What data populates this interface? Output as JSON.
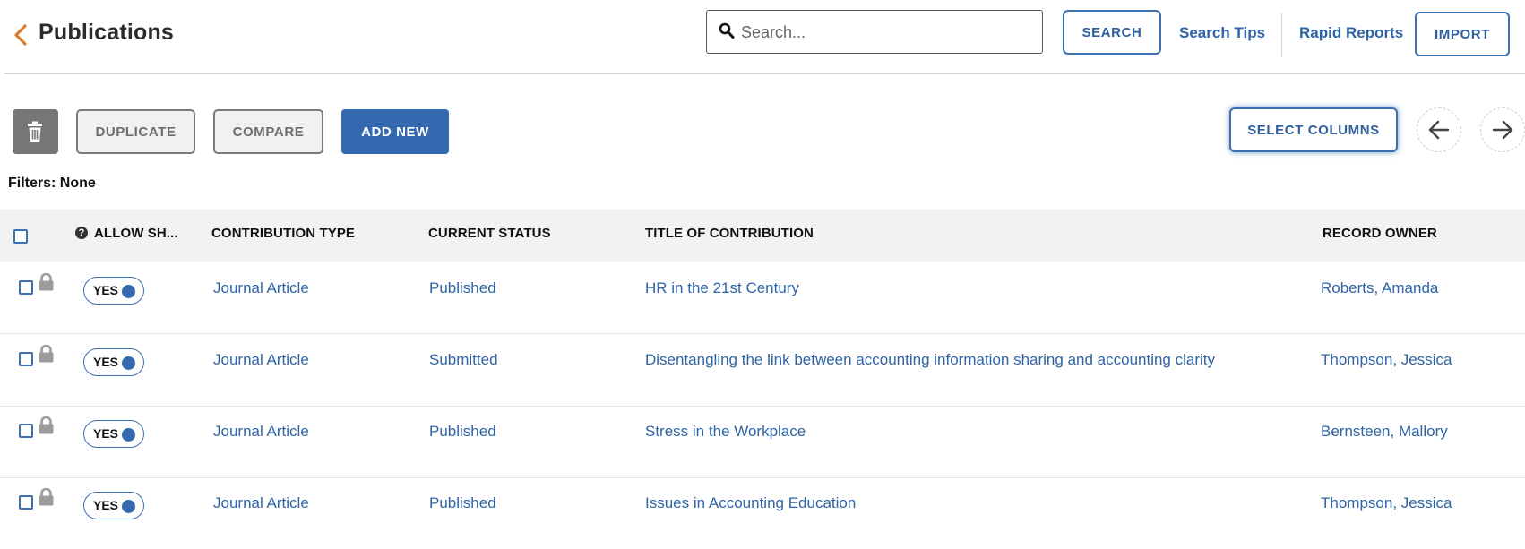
{
  "header": {
    "title": "Publications",
    "search_placeholder": "Search...",
    "search_button": "SEARCH",
    "search_tips": "Search Tips",
    "rapid_reports": "Rapid Reports",
    "import_button": "IMPORT"
  },
  "toolbar": {
    "duplicate": "DUPLICATE",
    "compare": "COMPARE",
    "add_new": "ADD NEW",
    "select_columns": "SELECT COLUMNS"
  },
  "filters": "Filters: None",
  "table": {
    "columns": [
      "ALLOW SH...",
      "CONTRIBUTION TYPE",
      "CURRENT STATUS",
      "TITLE OF CONTRIBUTION",
      "RECORD OWNER"
    ],
    "rows": [
      {
        "allow": "YES",
        "type": "Journal Article",
        "status": "Published",
        "title": "HR in the 21st Century",
        "owner": "Roberts, Amanda"
      },
      {
        "allow": "YES",
        "type": "Journal Article",
        "status": "Submitted",
        "title": "Disentangling the link between accounting information sharing and accounting clarity",
        "owner": "Thompson, Jessica"
      },
      {
        "allow": "YES",
        "type": "Journal Article",
        "status": "Published",
        "title": "Stress in the Workplace",
        "owner": "Bernsteen, Mallory"
      },
      {
        "allow": "YES",
        "type": "Journal Article",
        "status": "Published",
        "title": "Issues in Accounting Education",
        "owner": "Thompson, Jessica"
      }
    ]
  },
  "colors": {
    "accent": "#3469b0",
    "back_arrow": "#e07b2a",
    "link": "#2f64a6"
  }
}
